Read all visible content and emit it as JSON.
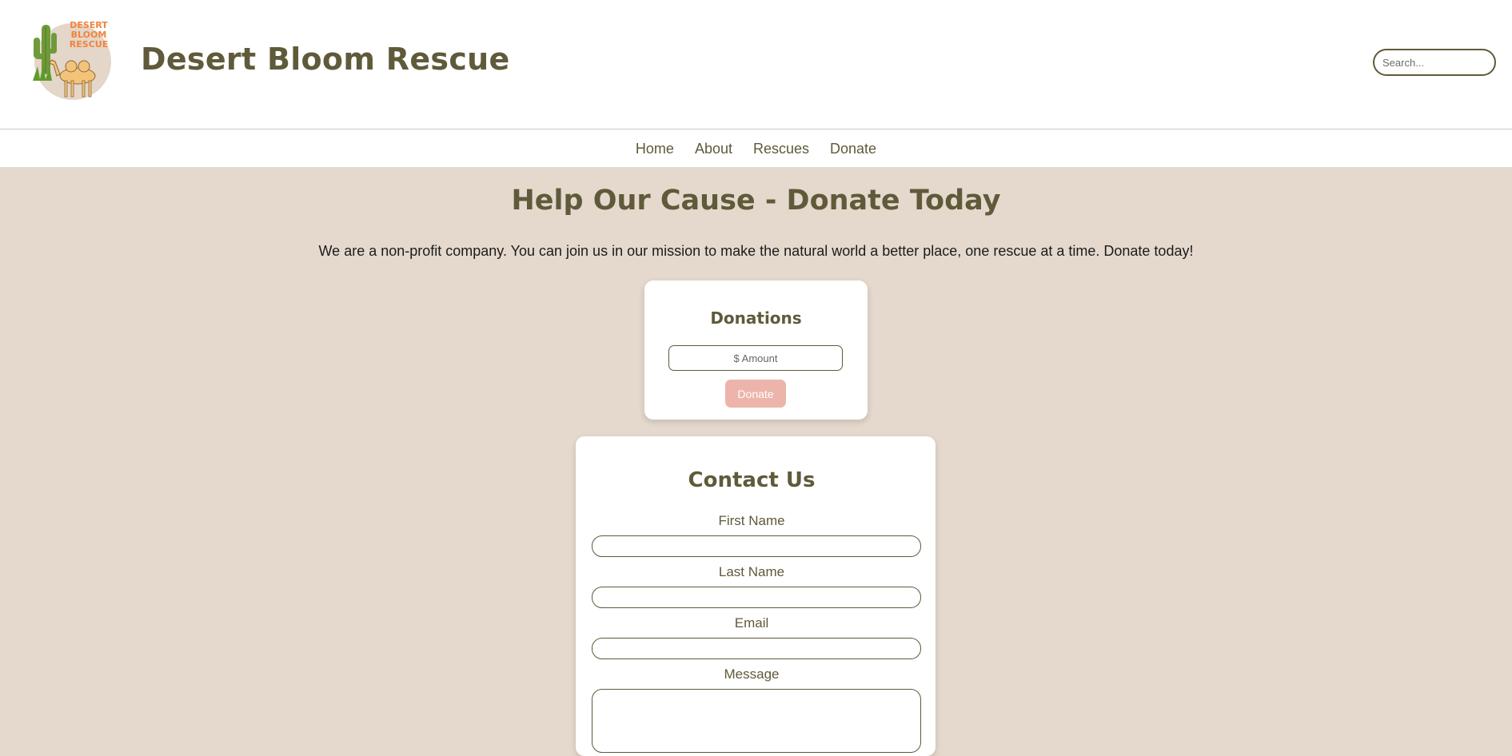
{
  "header": {
    "title": "Desert Bloom Rescue",
    "logo_lines": [
      "DESERT",
      "BLOOM",
      "RESCUE"
    ],
    "search_placeholder": "Search..."
  },
  "nav": {
    "items": [
      "Home",
      "About",
      "Rescues",
      "Donate"
    ]
  },
  "main": {
    "heading": "Help Our Cause - Donate Today",
    "intro": "We are a non-profit company. You can join us in our mission to make the natural world a better place, one rescue at a time. Donate today!"
  },
  "donations": {
    "title": "Donations",
    "amount_placeholder": "$ Amount",
    "button_label": "Donate"
  },
  "contact": {
    "title": "Contact Us",
    "first_name_label": "First Name",
    "last_name_label": "Last Name",
    "email_label": "Email",
    "message_label": "Message"
  },
  "colors": {
    "page_background": "#e5d9cd",
    "brand_olive": "#5f5a3a",
    "donate_button": "#edb4ab",
    "logo_orange": "#f0843c"
  }
}
